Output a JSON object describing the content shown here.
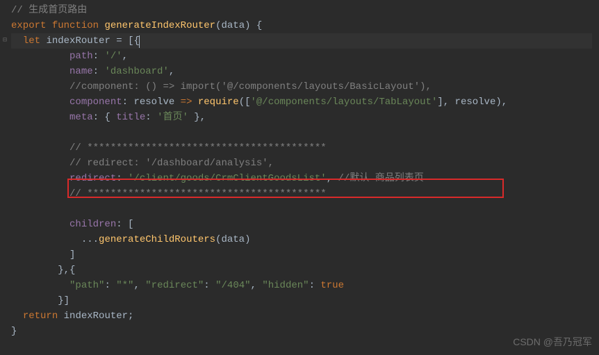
{
  "gutter": {
    "fold_marker": "⊟"
  },
  "code": {
    "l1_comment": "// 生成首页路由",
    "l2_export": "export",
    "l2_function": "function",
    "l2_name": "generateIndexRouter",
    "l2_params": "(data) {",
    "l3_let": "let",
    "l3_var": "indexRouter",
    "l3_eq": " = [{",
    "l4_key": "path",
    "l4_colon": ": ",
    "l4_val": "'/'",
    "l4_comma": ",",
    "l5_key": "name",
    "l5_val": "'dashboard'",
    "l6_comment": "//component: () => import('@/components/layouts/BasicLayout'),",
    "l7_key": "component",
    "l7_resolve": "resolve",
    "l7_arrow": " => ",
    "l7_require": "require",
    "l7_open": "([",
    "l7_str": "'@/components/layouts/TabLayout'",
    "l7_close": "], resolve),",
    "l8_key": "meta",
    "l8_open": ": { ",
    "l8_title": "title",
    "l8_tcolon": ": ",
    "l8_tstr": "'首页'",
    "l8_close": " },",
    "l10_stars": "// *****************************************",
    "l11_comment": "// redirect: '/dashboard/analysis',",
    "l12_key": "redirect",
    "l12_val": "'/client/goods/CrmClientGoodsList'",
    "l12_trail": "//默认 商品列表页",
    "l13_stars": "// *****************************************",
    "l15_key": "children",
    "l15_open": ": [",
    "l16_spread": "...",
    "l16_fn": "generateChildRouters",
    "l16_args": "(data)",
    "l17_close": "]",
    "l18_close": "},{",
    "l19_path_k": "\"path\"",
    "l19_path_v": "\"*\"",
    "l19_redir_k": "\"redirect\"",
    "l19_redir_v": "\"/404\"",
    "l19_hidden_k": "\"hidden\"",
    "l19_hidden_v": "true",
    "l20_close": "}]",
    "l21_return": "return",
    "l21_var": "indexRouter;",
    "l22_close": "}"
  },
  "watermark": "CSDN @吾乃冠军"
}
